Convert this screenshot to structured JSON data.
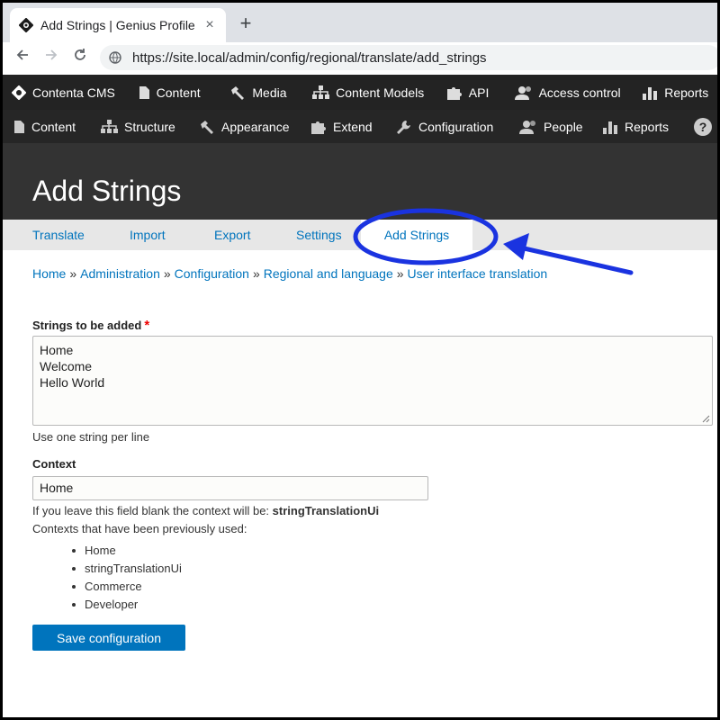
{
  "browser": {
    "tab_title": "Add Strings | Genius Profile",
    "tab_close": "×",
    "new_tab": "+",
    "url": "https://site.local/admin/config/regional/translate/add_strings"
  },
  "toolbar1": {
    "items": [
      "Contenta CMS",
      "Content",
      "Media",
      "Content Models",
      "API",
      "Access control",
      "Reports"
    ]
  },
  "toolbar2": {
    "items": [
      "Content",
      "Structure",
      "Appearance",
      "Extend",
      "Configuration",
      "People",
      "Reports"
    ],
    "help": "?"
  },
  "page": {
    "title": "Add Strings"
  },
  "tabs": {
    "items": [
      "Translate",
      "Import",
      "Export",
      "Settings",
      "Add Strings"
    ],
    "active": "Add Strings"
  },
  "breadcrumb": {
    "items": [
      "Home",
      "Administration",
      "Configuration",
      "Regional and language",
      "User interface translation"
    ],
    "separator": "»"
  },
  "form": {
    "strings_label": "Strings to be added",
    "required_mark": "*",
    "strings_lines": [
      "Home",
      "Welcome",
      "Hello World"
    ],
    "strings_help": "Use one string per line",
    "context_label": "Context",
    "context_value": "Home",
    "context_help_prefix": "If you leave this field blank the context will be: ",
    "context_help_default": "stringTranslationUi",
    "previous_label": "Contexts that have been previously used:",
    "previous_contexts": [
      "Home",
      "stringTranslationUi",
      "Commerce",
      "Developer"
    ],
    "save_label": "Save configuration"
  },
  "colors": {
    "link": "#0074bd",
    "toolbar": "#232323",
    "header": "#333333",
    "annotation": "#1a33e0",
    "primary_button": "#0074bd"
  }
}
